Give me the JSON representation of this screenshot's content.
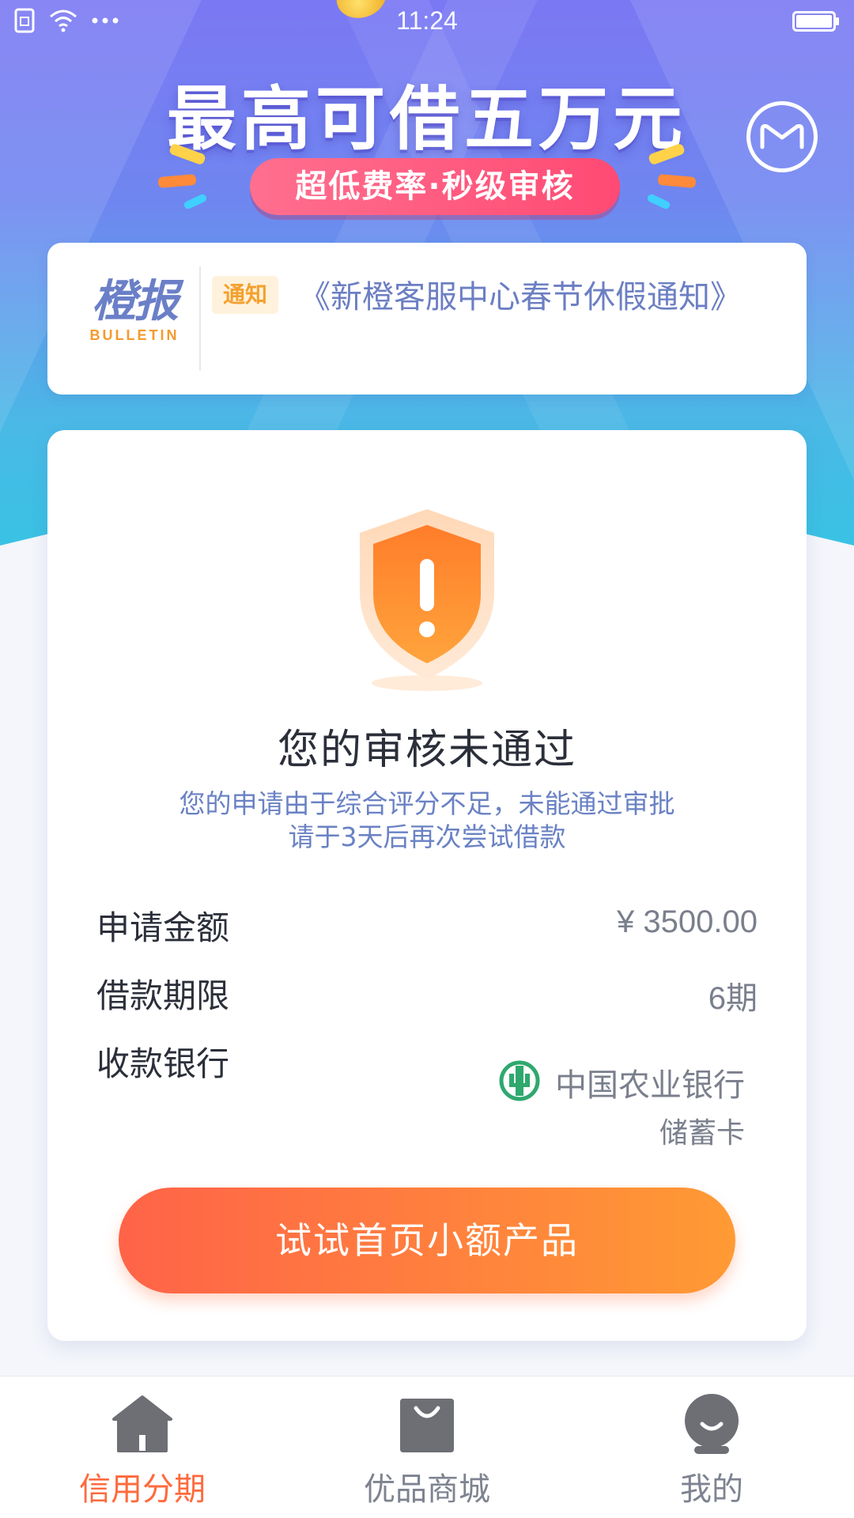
{
  "status_bar": {
    "time": "11:24",
    "icons": [
      "sim-icon",
      "wifi-icon",
      "more-dots-icon",
      "battery-icon"
    ]
  },
  "hero": {
    "title": "最高可借五万元",
    "subtitle": "超低费率·秒级审核",
    "message_icon": "message-icon"
  },
  "bulletin": {
    "logo_main": "橙报",
    "logo_sub": "BULLETIN",
    "tag": "通知",
    "text": "《新橙客服中心春节休假通知》"
  },
  "result": {
    "icon": "shield-warning-icon",
    "title": "您的审核未通过",
    "desc_line1": "您的申请由于综合评分不足，未能通过审批",
    "desc_line2": "请于3天后再次尝试借款"
  },
  "details": {
    "amount_label": "申请金额",
    "amount_value": "¥ 3500.00",
    "term_label": "借款期限",
    "term_value": "6期",
    "bank_label": "收款银行",
    "bank_name": "中国农业银行",
    "bank_card_type": "储蓄卡",
    "bank_icon": "abc-bank-logo"
  },
  "cta": {
    "label": "试试首页小额产品"
  },
  "tabs": [
    {
      "label": "信用分期",
      "icon": "home-icon",
      "active": true
    },
    {
      "label": "优品商城",
      "icon": "shopping-bag-icon",
      "active": false
    },
    {
      "label": "我的",
      "icon": "profile-icon",
      "active": false
    }
  ],
  "colors": {
    "accent": "#ff6a3d",
    "hero_top": "#7b78f3",
    "hero_bottom": "#35c4e3",
    "desc_blue": "#6a82c4",
    "shield_orange": "#ff8a2a"
  }
}
